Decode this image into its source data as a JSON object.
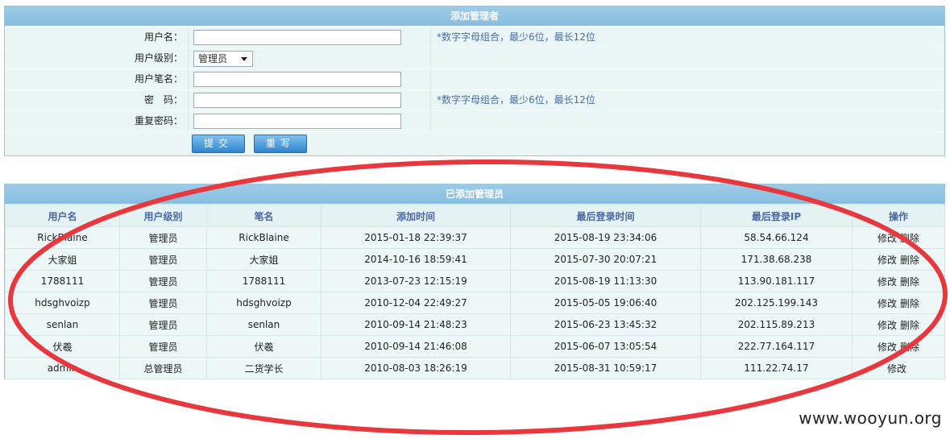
{
  "form": {
    "title": "添加管理者",
    "username_label": "用户名：",
    "level_label": "用户级别：",
    "level_value": "管理员",
    "nickname_label": "用户笔名：",
    "password_label": "密　码：",
    "confirm_label": "重复密码：",
    "hint": "*数字字母组合，最少6位，最长12位",
    "submit_label": "提交",
    "reset_label": "重写"
  },
  "list": {
    "title": "已添加管理员",
    "columns": [
      "用户名",
      "用户级别",
      "笔名",
      "添加时间",
      "最后登录时间",
      "最后登录IP",
      "操作"
    ],
    "rows": [
      {
        "user": "RickBlaine",
        "level": "管理员",
        "pen": "RickBlaine",
        "added": "2015-01-18 22:39:37",
        "last": "2015-08-19 23:34:06",
        "ip": "58.54.66.124",
        "edit": "修改",
        "del": "删除"
      },
      {
        "user": "大家姐",
        "level": "管理员",
        "pen": "大家姐",
        "added": "2014-10-16 18:59:41",
        "last": "2015-07-30 20:07:21",
        "ip": "171.38.68.238",
        "edit": "修改",
        "del": "删除"
      },
      {
        "user": "1788111",
        "level": "管理员",
        "pen": "1788111",
        "added": "2013-07-23 12:15:19",
        "last": "2015-08-19 11:13:30",
        "ip": "113.90.181.117",
        "edit": "修改",
        "del": "删除"
      },
      {
        "user": "hdsghvoizp",
        "level": "管理员",
        "pen": "hdsghvoizp",
        "added": "2010-12-04 22:49:27",
        "last": "2015-05-05 19:06:40",
        "ip": "202.125.199.143",
        "edit": "修改",
        "del": "删除"
      },
      {
        "user": "senlan",
        "level": "管理员",
        "pen": "senlan",
        "added": "2010-09-14 21:48:23",
        "last": "2015-06-23 13:45:32",
        "ip": "202.115.89.213",
        "edit": "修改",
        "del": "删除"
      },
      {
        "user": "伏羲",
        "level": "管理员",
        "pen": "伏羲",
        "added": "2010-09-14 21:46:08",
        "last": "2015-06-07 13:05:54",
        "ip": "222.77.164.117",
        "edit": "修改",
        "del": "删除"
      },
      {
        "user": "admin",
        "level": "总管理员",
        "pen": "二货学长",
        "added": "2010-08-03 18:26:19",
        "last": "2015-08-31 10:59:17",
        "ip": "111.22.74.17",
        "edit": "修改",
        "del": ""
      }
    ]
  },
  "watermark": "www.wooyun.org",
  "colors": {
    "annotation": "#e8383d",
    "header": "#8cc3e3",
    "accent": "#4767a8"
  }
}
